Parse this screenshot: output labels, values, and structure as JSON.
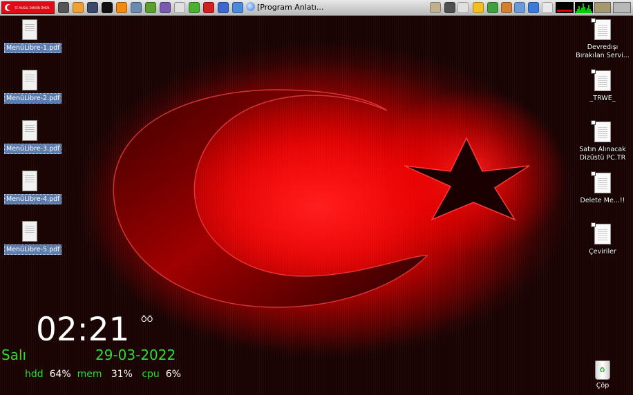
{
  "taskbar": {
    "logo_text": "TC MUSUL ÖMRÜN ÖMÜR",
    "launcher_icons": [
      {
        "name": "search-icon",
        "color": "#555555"
      },
      {
        "name": "notes-icon",
        "color": "#f0a030"
      },
      {
        "name": "monitor-icon",
        "color": "#3a4a6a"
      },
      {
        "name": "amazon-icon",
        "color": "#111111"
      },
      {
        "name": "vlc-icon",
        "color": "#f08a10"
      },
      {
        "name": "gallery-icon",
        "color": "#6a8ab0"
      },
      {
        "name": "update-icon",
        "color": "#5aa02a"
      },
      {
        "name": "calculator-icon",
        "color": "#7a5ab0"
      },
      {
        "name": "inkscape-icon",
        "color": "#e0e0e0"
      },
      {
        "name": "leaf-icon",
        "color": "#4ab030"
      },
      {
        "name": "cherry-icon",
        "color": "#d02020"
      },
      {
        "name": "chat-icon",
        "color": "#3a6ad0"
      },
      {
        "name": "globe-icon",
        "color": "#4a8ad8"
      }
    ],
    "window_title": "[Program Anlatı...",
    "tray_icons": [
      {
        "name": "clipboard-icon",
        "color": "#c0b090"
      },
      {
        "name": "disk-icon",
        "color": "#505050"
      },
      {
        "name": "usb-icon",
        "color": "#e0e0e0"
      },
      {
        "name": "wifi-icon",
        "color": "#f0c020"
      },
      {
        "name": "shield-icon",
        "color": "#40a040"
      },
      {
        "name": "volume-icon",
        "color": "#d08030"
      },
      {
        "name": "network-icon",
        "color": "#6a9ad8"
      },
      {
        "name": "download-icon",
        "color": "#3a7ad8"
      },
      {
        "name": "windows-icon",
        "color": "#e8e8e8"
      }
    ]
  },
  "desktop_left": [
    {
      "label": "MenüLibre-1.pdf"
    },
    {
      "label": "MenüLibre-2.pdf"
    },
    {
      "label": "MenüLibre-3.pdf"
    },
    {
      "label": "MenüLibre-4.pdf"
    },
    {
      "label": "MenüLibre-5.pdf"
    }
  ],
  "desktop_right": [
    {
      "line1": "Devredışı",
      "line2": "Bırakılan Servi..."
    },
    {
      "line1": "_TRWE_",
      "line2": ""
    },
    {
      "line1": "Satın Alınacak",
      "line2": "Dizüstü PC.TR"
    },
    {
      "line1": "Delete Me...!!",
      "line2": ""
    },
    {
      "line1": "Çeviriler",
      "line2": ""
    }
  ],
  "conky": {
    "time": "02:21",
    "suffix": "ÖÖ",
    "day": "Salı",
    "date": "29-03-2022",
    "hdd_label": "hdd",
    "hdd_value": "64%",
    "mem_label": "mem",
    "mem_value": "31%",
    "cpu_label": "cpu",
    "cpu_value": "6%"
  },
  "trash": {
    "label": "Çöp"
  }
}
